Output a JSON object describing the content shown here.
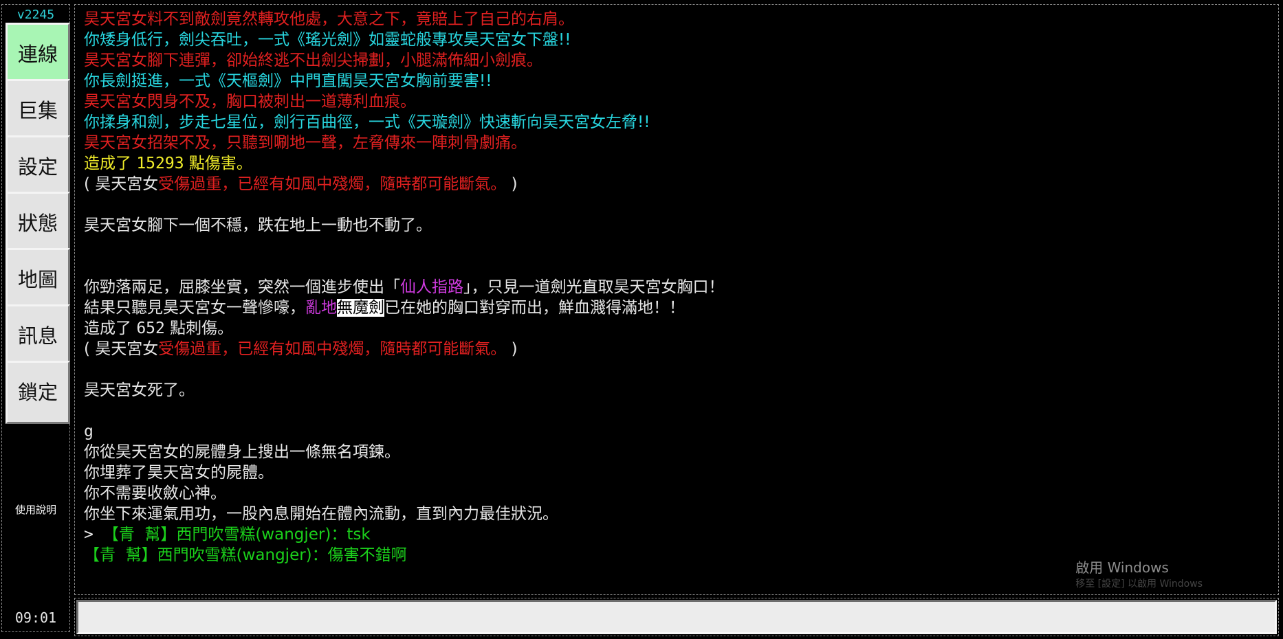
{
  "sidebar": {
    "version": "v2245",
    "buttons": [
      {
        "label": "連線",
        "active": true
      },
      {
        "label": "巨集"
      },
      {
        "label": "設定"
      },
      {
        "label": "狀態"
      },
      {
        "label": "地圖"
      },
      {
        "label": "訊息"
      },
      {
        "label": "鎖定"
      }
    ],
    "help_label": "使用說明",
    "clock": "09:01"
  },
  "log": [
    [
      {
        "t": "昊天宮女料不到敵劍竟然轉攻他處，大意之下，竟賠上了自己的右肩。",
        "c": "red"
      }
    ],
    [
      {
        "t": "你矮身低行，劍尖吞吐，一式《瑤光劍》如靈蛇般專攻昊天宮女下盤!!",
        "c": "cyan"
      }
    ],
    [
      {
        "t": "昊天宮女腳下連彈，卻始終逃不出劍尖掃劃，小腿滿佈細小劍痕。",
        "c": "red"
      }
    ],
    [
      {
        "t": "你長劍挺進，一式《天樞劍》中門直闖昊天宮女胸前要害!!",
        "c": "cyan"
      }
    ],
    [
      {
        "t": "昊天宮女閃身不及，胸口被刺出一道薄利血痕。",
        "c": "red"
      }
    ],
    [
      {
        "t": "你揉身和劍，步走七星位，劍行百曲徑，一式《天璇劍》快速斬向昊天宮女左脅!!",
        "c": "cyan"
      }
    ],
    [
      {
        "t": "昊天宮女招架不及，只聽到唰地一聲，左脅傳來一陣刺骨劇痛。",
        "c": "red"
      }
    ],
    [
      {
        "t": "造成了 ",
        "c": "yellow"
      },
      {
        "t": "15293",
        "c": "yellow mono"
      },
      {
        "t": " 點傷害。",
        "c": "yellow"
      }
    ],
    [
      {
        "t": "( 昊天宮女",
        "c": "white"
      },
      {
        "t": "受傷過重，已經有如風中殘燭，隨時都可能斷氣。",
        "c": "red"
      },
      {
        "t": " )",
        "c": "white"
      }
    ],
    [
      {
        "t": "",
        "c": "white"
      }
    ],
    [
      {
        "t": "昊天宮女腳下一個不穩，跌在地上一動也不動了。",
        "c": "white"
      }
    ],
    [
      {
        "t": "",
        "c": "white"
      }
    ],
    [
      {
        "t": "",
        "c": "white"
      }
    ],
    [
      {
        "t": "你勁落兩足，屈膝坐實，突然一個進步使出「",
        "c": "white"
      },
      {
        "t": "仙人指路",
        "c": "magenta"
      },
      {
        "t": "」，只見一道劍光直取昊天宮女胸口！",
        "c": "white"
      }
    ],
    [
      {
        "t": "結果只聽見昊天宮女一聲慘嚎，",
        "c": "white"
      },
      {
        "t": "亂地",
        "c": "magenta"
      },
      {
        "t": "無魔劍",
        "c": "hl"
      },
      {
        "t": "已在她的胸口對穿而出，鮮血濺得滿地！！",
        "c": "white"
      }
    ],
    [
      {
        "t": "造成了 ",
        "c": "white"
      },
      {
        "t": "652",
        "c": "white mono"
      },
      {
        "t": " 點刺傷。",
        "c": "white"
      }
    ],
    [
      {
        "t": "( 昊天宮女",
        "c": "white"
      },
      {
        "t": "受傷過重，已經有如風中殘燭，隨時都可能斷氣。",
        "c": "red"
      },
      {
        "t": " )",
        "c": "white"
      }
    ],
    [
      {
        "t": "",
        "c": "white"
      }
    ],
    [
      {
        "t": "昊天宮女死了。",
        "c": "white"
      }
    ],
    [
      {
        "t": "",
        "c": "white"
      }
    ],
    [
      {
        "t": "g",
        "c": "white mono"
      }
    ],
    [
      {
        "t": "你從昊天宮女的屍體身上搜出一條無名項鍊。",
        "c": "white"
      }
    ],
    [
      {
        "t": "你埋葬了昊天宮女的屍體。",
        "c": "white"
      }
    ],
    [
      {
        "t": "你不需要收斂心神。",
        "c": "white"
      }
    ],
    [
      {
        "t": "你坐下來運氣用功，一股內息開始在體內流動，直到內力最佳狀況。",
        "c": "white"
      }
    ],
    [
      {
        "t": "> ",
        "c": "white mono"
      },
      {
        "t": "【青  幫】西門吹雪糕(wangjer)：tsk",
        "c": "green"
      }
    ],
    [
      {
        "t": "【青  幫】西門吹雪糕(wangjer)：傷害不錯啊",
        "c": "green"
      }
    ]
  ],
  "watermark": {
    "title": "啟用 Windows",
    "subtitle": "移至 [設定] 以啟用 Windows"
  },
  "input": {
    "value": "",
    "placeholder": ""
  }
}
